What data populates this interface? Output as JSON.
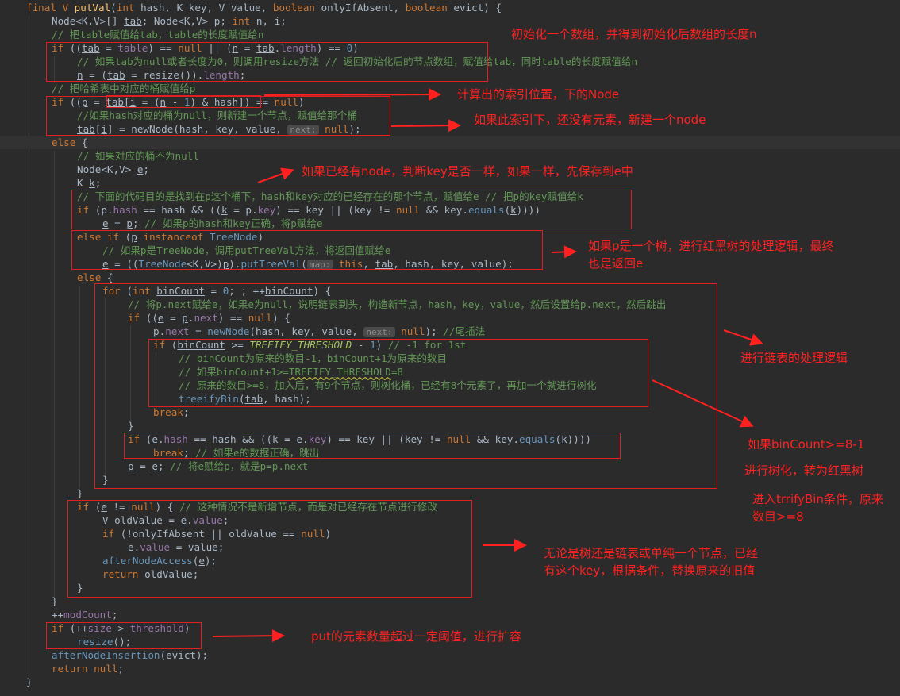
{
  "code": {
    "l1": {
      "a": "final V ",
      "b": "putVal",
      "c": "(",
      "d": "int",
      "e": " hash, K key, V value, ",
      "f": "boolean",
      "g": " onlyIfAbsent, ",
      "h": "boolean",
      "i": " evict) {"
    },
    "l2": {
      "a": "Node<K,V>[] ",
      "b": "tab",
      "c": "; Node<K,V> p; ",
      "d": "int",
      "e": " n, i;"
    },
    "l3": "// 把table赋值给tab，table的长度赋值给n",
    "l4": {
      "a": "if",
      "b": " ((",
      "c": "tab",
      "d": " = ",
      "e": "table",
      "f": ") == ",
      "g": "null",
      "h": " || (",
      "i": "n",
      "j": " = ",
      "k": "tab",
      "l": ".",
      "m": "length",
      "n": ") == ",
      "o": "0",
      "p": ")"
    },
    "l5": "// 如果tab为null或者长度为0，则调用resize方法 // 返回初始化后的节点数组，赋值给tab，同时table的长度赋值给n",
    "l6": {
      "a": "n",
      "b": " = (",
      "c": "tab",
      "d": " = resize()).",
      "e": "length",
      "f": ";"
    },
    "l7": "// 把哈希表中对应的桶赋值给p",
    "l8": {
      "a": "if",
      "b": " ((",
      "c": "p",
      "d": " = ",
      "e": "tab[",
      "f": "i",
      "g": " = (",
      "h": "n",
      "i": " - ",
      "j": "1",
      "k": ") & hash]",
      "l": ") == ",
      "m": "null",
      "n": ")"
    },
    "l9": "//如果hash对应的桶为null，则新建一个节点，赋值给那个桶",
    "l10": {
      "a": "tab",
      "b": "[",
      "c": "i",
      "d": "] = newNode(hash, key, value, ",
      "hint": "next:",
      "e": " ",
      "f": "null",
      "g": ");"
    },
    "l11": {
      "a": "else",
      "b": " {"
    },
    "l12": "// 如果对应的桶不为null",
    "l13": {
      "a": "Node<K,V> ",
      "b": "e",
      "c": ";"
    },
    "l14": {
      "a": "K ",
      "b": "k",
      "c": ";"
    },
    "l15": "// 下面的代码目的是找到在p这个桶下，hash和key对应的已经存在的那个节点，赋值给e // 把p的key赋值给k",
    "l16": {
      "a": "if",
      "b": " (p.",
      "c": "hash",
      "d": " == hash && ((",
      "e": "k",
      "f": " = p.",
      "g": "key",
      "h": ") == key || (key != ",
      "i": "null",
      "j": " && key.",
      "k": "equals",
      "l": "(",
      "m": "k",
      "n": "))))"
    },
    "l17": {
      "a": "e",
      "b": " = ",
      "c": "p",
      "d": "; ",
      "cm": "// 如果p的hash和key正确，将p赋给e"
    },
    "l18": {
      "a": "else if",
      "b": " (",
      "c": "p",
      "d": " ",
      "e": "instanceof",
      "f": " ",
      "g": "TreeNode",
      "h": ")"
    },
    "l19": "// 如果p是TreeNode，调用putTreeVal方法，将返回值赋给e",
    "l20": {
      "a": "e",
      "b": " = ((",
      "c": "TreeNode",
      "d": "<K,V>)",
      "e": "p",
      "f": ").",
      "g": "putTreeVal",
      "h": "(",
      "hint": "map:",
      "i": " ",
      "j": "this",
      "k": ", ",
      "l": "tab",
      "m": ", hash, key, value);"
    },
    "l21": {
      "a": "else",
      "b": " {"
    },
    "l22": {
      "a": "for",
      "b": " (",
      "c": "int",
      "d": " ",
      "e": "binCount",
      "f": " = ",
      "g": "0",
      "h": "; ; ++",
      "i": "binCount",
      "j": ") {"
    },
    "l23": "// 将p.next赋给e，如果e为null，说明链表到头，构造新节点，hash，key，value，然后设置给p.next，然后跳出",
    "l24": {
      "a": "if",
      "b": " ((",
      "c": "e",
      "d": " = ",
      "e": "p",
      "f": ".",
      "g": "next",
      "h": ") == ",
      "i": "null",
      "j": ") {"
    },
    "l25": {
      "a": "p",
      "b": ".",
      "c": "next",
      "d": " = ",
      "e": "newNode",
      "f": "(hash, key, value, ",
      "hint": "next:",
      "g": " ",
      "h": "null",
      "i": "); ",
      "cm": "//尾插法"
    },
    "l26": {
      "a": "if",
      "b": " (",
      "c": "binCount",
      "d": " >= ",
      "e": "TREEIFY_THRESHOLD",
      "f": " - ",
      "g": "1",
      "h": ") ",
      "cm": "// -1 for 1st"
    },
    "l27": "// binCount为原来的数目-1，binCount+1为原来的数目",
    "l28": {
      "a": "// 如果binCount+1>=",
      "b": "TREEIFY_THRESHOLD",
      "c": "=8"
    },
    "l29": "// 原来的数目>=8，加入后，有9个节点，则树化桶，已经有8个元素了，再加一个就进行树化",
    "l30": {
      "a": "treeifyBin",
      "b": "(",
      "c": "tab",
      "d": ", hash);"
    },
    "l31": {
      "a": "break",
      "b": ";"
    },
    "l32": "}",
    "l33": {
      "a": "if",
      "b": " (",
      "c": "e",
      "d": ".",
      "e": "hash",
      "f": " == hash && ((",
      "g": "k",
      "h": " = ",
      "i": "e",
      "j": ".",
      "k": "key",
      "l": ") == key || (key != ",
      "m": "null",
      "n": " && key.",
      "o": "equals",
      "p": "(",
      "q": "k",
      "r": "))))"
    },
    "l34": {
      "a": "break",
      "b": "; ",
      "cm": "// 如果e的数据正确，跳出"
    },
    "l35": {
      "a": "p",
      "b": " = ",
      "c": "e",
      "d": "; ",
      "cm": "// 将e赋给p，就是p=p.next"
    },
    "l36": "}",
    "l37": "}",
    "l38": {
      "a": "if",
      "b": " (",
      "c": "e",
      "d": " != ",
      "e": "null",
      "f": ") { ",
      "cm": "// 这种情况不是新增节点，而是对已经存在节点进行修改"
    },
    "l39": {
      "a": "V oldValue = ",
      "b": "e",
      "c": ".",
      "d": "value",
      "e": ";"
    },
    "l40": {
      "a": "if",
      "b": " (!onlyIfAbsent || oldValue == ",
      "c": "null",
      "d": ")"
    },
    "l41": {
      "a": "e",
      "b": ".",
      "c": "value",
      "d": " = value;"
    },
    "l42": {
      "a": "afterNodeAccess",
      "b": "(",
      "c": "e",
      "d": ");"
    },
    "l43": {
      "a": "return",
      "b": " oldValue;"
    },
    "l44": "}",
    "l45": "}",
    "l46": {
      "a": "++",
      "b": "modCount",
      "c": ";"
    },
    "l47": {
      "a": "if",
      "b": " (++",
      "c": "size",
      "d": " > ",
      "e": "threshold",
      "f": ")"
    },
    "l48": {
      "a": "resize",
      "b": "();"
    },
    "l49": {
      "a": "afterNodeInsertion",
      "b": "(evict);"
    },
    "l50": {
      "a": "return",
      "b": " ",
      "c": "null",
      "d": ";"
    },
    "l51": "}"
  },
  "annotations": {
    "a1": "初始化一个数组，并得到初始化后数组的长度n",
    "a2": "计算出的索引位置，下的Node",
    "a3": "如果此索引下，还没有元素，新建一个node",
    "a4": "如果已经有node，判断key是否一样，如果一样，先保存到e中",
    "a5_l1": "如果p是一个树，进行红黑树的处理逻辑，最终",
    "a5_l2": "也是返回e",
    "a6": "进行链表的处理逻辑",
    "a7": "如果binCount>=8-1",
    "a8": "进行树化，转为红黑树",
    "a9_l1": "进入trrifyBin条件，原来",
    "a9_l2": "数目>=8",
    "a10_l1": "无论是树还是链表或单纯一个节点，已经",
    "a10_l2": "有这个key，根据条件，替换原来的旧值",
    "a11": "put的元素数量超过一定阈值，进行扩容"
  },
  "colors": {
    "background": "#2b2b2b",
    "keyword": "#cc7832",
    "comment": "#629755",
    "field": "#9876aa",
    "method": "#ffc66d",
    "number": "#6897bb",
    "annotation": "#ff2020"
  }
}
